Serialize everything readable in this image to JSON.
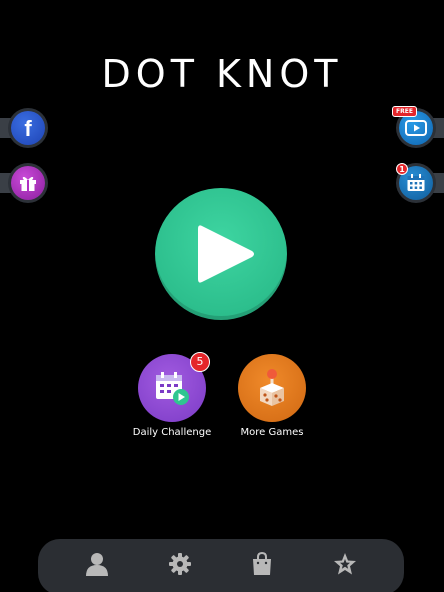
{
  "app": {
    "title": "DOT KNOT"
  },
  "side": {
    "facebook": {
      "icon": "facebook-icon",
      "glyph": "f"
    },
    "gift": {
      "icon": "gift-icon"
    },
    "video": {
      "icon": "video-play-icon",
      "badge": "FREE"
    },
    "calendar": {
      "icon": "calendar-icon",
      "badge": "1"
    }
  },
  "play": {
    "icon": "play-icon"
  },
  "menu": {
    "daily": {
      "label": "Daily Challenge",
      "badge": "5",
      "icon": "calendar-play-icon"
    },
    "more": {
      "label": "More Games",
      "icon": "joystick-dice-icon"
    }
  },
  "bottom_nav": [
    {
      "icon": "profile-icon"
    },
    {
      "icon": "settings-gear-icon"
    },
    {
      "icon": "shop-bag-icon"
    },
    {
      "icon": "star-badge-icon"
    }
  ],
  "colors": {
    "play": "#2fc690",
    "daily": "#8e4ad6",
    "more": "#e77a1e",
    "badge": "#e4262b"
  }
}
